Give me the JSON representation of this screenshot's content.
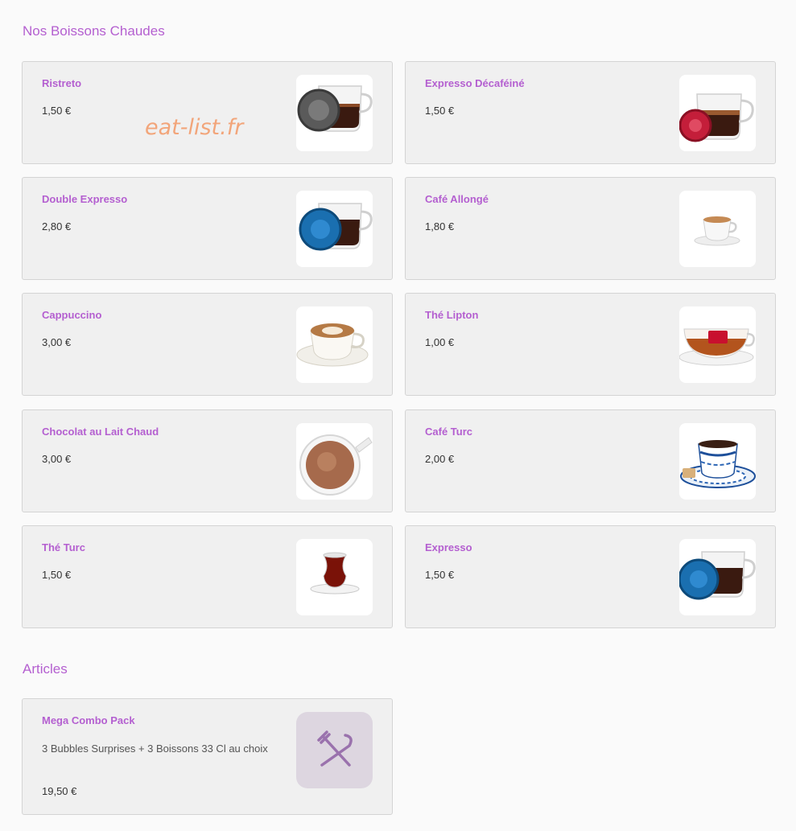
{
  "sections": {
    "hot_drinks": {
      "title": "Nos Boissons Chaudes"
    },
    "articles": {
      "title": "Articles"
    }
  },
  "watermark": "eat-list.fr",
  "items": [
    {
      "name": "Ristreto",
      "price": "1,50 €",
      "icon": "espresso-glass-grey-capsule"
    },
    {
      "name": "Expresso Décaféiné",
      "price": "1,50 €",
      "icon": "espresso-glass-red-capsule"
    },
    {
      "name": "Double Expresso",
      "price": "2,80 €",
      "icon": "espresso-glass-blue-capsule"
    },
    {
      "name": "Café Allongé",
      "price": "1,80 €",
      "icon": "small-coffee-cup"
    },
    {
      "name": "Cappuccino",
      "price": "3,00 €",
      "icon": "cappuccino-cup"
    },
    {
      "name": "Thé Lipton",
      "price": "1,00 €",
      "icon": "tea-glass-cup"
    },
    {
      "name": "Chocolat au Lait Chaud",
      "price": "3,00 €",
      "icon": "hot-chocolate-mug"
    },
    {
      "name": "Café Turc",
      "price": "2,00 €",
      "icon": "turkish-coffee-cup"
    },
    {
      "name": "Thé Turc",
      "price": "1,50 €",
      "icon": "turkish-tea-glass"
    },
    {
      "name": "Expresso",
      "price": "1,50 €",
      "icon": "espresso-glass-blue-capsule"
    }
  ],
  "article": {
    "name": "Mega Combo Pack",
    "description": "3 Bubbles Surprises + 3 Boissons 33 Cl au choix",
    "price": "19,50 €",
    "icon": "fork-knife-icon"
  },
  "colors": {
    "accent": "#b45fd0",
    "card_bg": "#f0f0f0",
    "card_border": "#d4d4d4",
    "placeholder_bg": "#ddd6e0",
    "placeholder_icon": "#9a72ad",
    "watermark": "#f2a57a"
  }
}
